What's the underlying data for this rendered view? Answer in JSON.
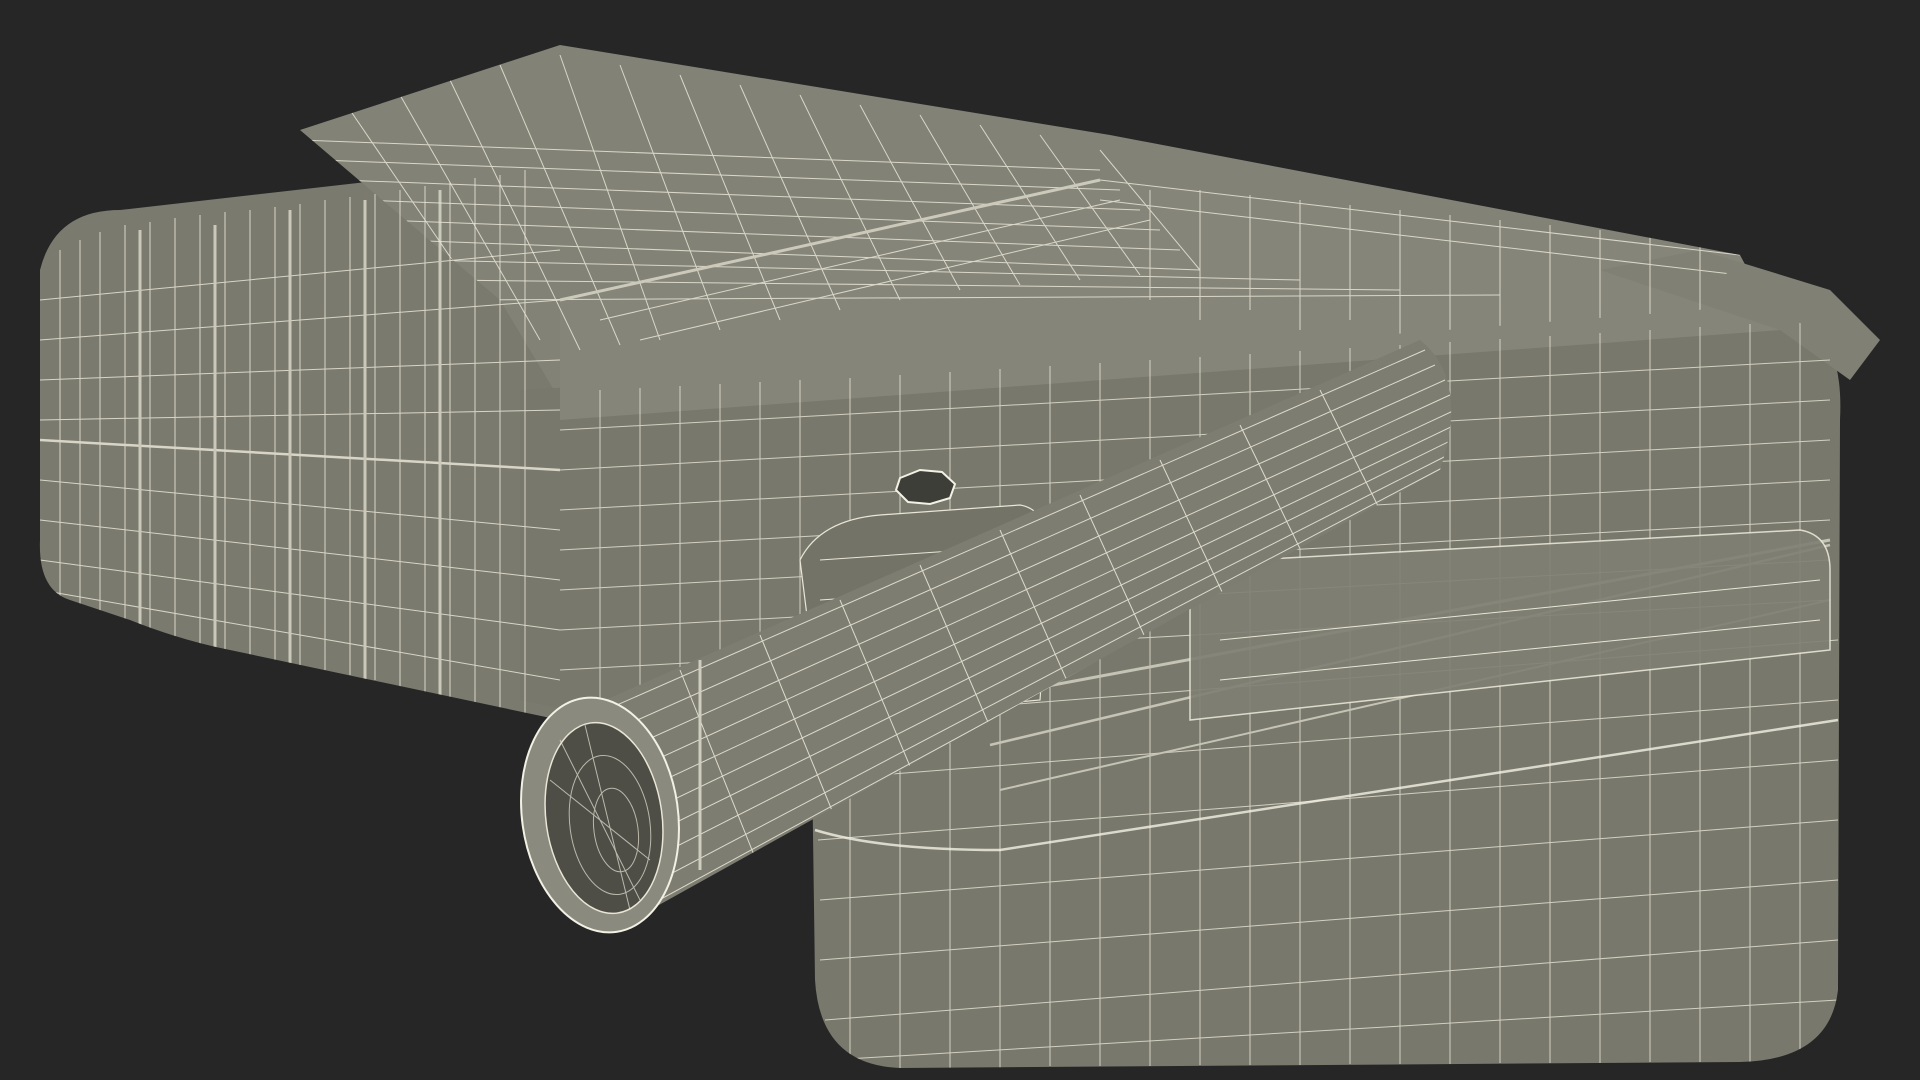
{
  "scene": {
    "subject_icon": "wireframe-fuel-canister-icon",
    "colors": {
      "background": "#262626",
      "surface": "#7b7b70",
      "surface_light": "#8a8a7f",
      "surface_dark": "#5f5f56",
      "wire": "#e9e6d6",
      "wire_dense": "#f3f1e4",
      "opening": "#4e4e47"
    }
  }
}
